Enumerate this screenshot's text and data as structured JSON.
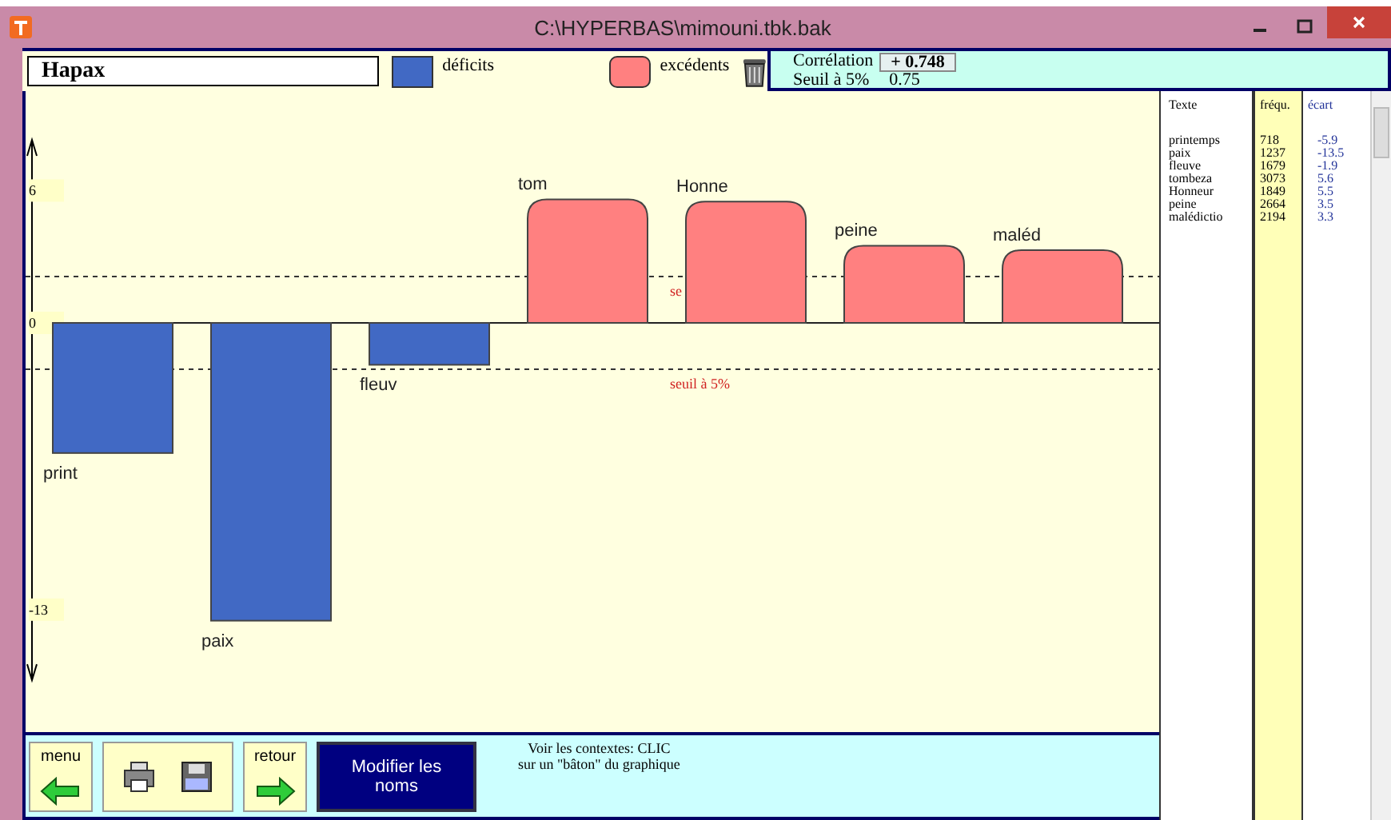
{
  "window": {
    "title": "C:\\HYPERBAS\\mimouni.tbk.bak"
  },
  "toolbar": {
    "name": "Hapax"
  },
  "correlation": {
    "label": "Corrélation",
    "value": "+ 0.748",
    "threshold_label": "Seuil à 5%",
    "threshold_value": "0.75"
  },
  "chart_data": {
    "type": "bar",
    "ylim": [
      -16.2,
      8.3
    ],
    "yticks": [
      6,
      0,
      -13
    ],
    "categories": [
      "print",
      "paix",
      "fleuv",
      "tom",
      "Honne",
      "peine",
      "maléd"
    ],
    "series": [
      {
        "name": "déficits",
        "color": "#4169c4",
        "values": [
          -5.9,
          -13.5,
          -1.9,
          null,
          null,
          null,
          null
        ]
      },
      {
        "name": "excédents",
        "color": "#ff8080",
        "values": [
          null,
          null,
          null,
          5.6,
          5.5,
          3.5,
          3.3
        ]
      }
    ],
    "ref_lines": [
      {
        "axis": "y",
        "value": 2.1,
        "label": "se"
      },
      {
        "axis": "y",
        "value": -2.1,
        "label": "seuil à 5%"
      }
    ]
  },
  "table": {
    "columns": [
      "Texte",
      "fréqu.",
      "écart"
    ],
    "rows": [
      [
        "printemps",
        "718",
        "-5.9"
      ],
      [
        "paix",
        "1237",
        "-13.5"
      ],
      [
        "fleuve",
        "1679",
        "-1.9"
      ],
      [
        "tombeza",
        "3073",
        "5.6"
      ],
      [
        "Honneur",
        "1849",
        "5.5"
      ],
      [
        "peine",
        "2664",
        "3.5"
      ],
      [
        "malédictio",
        "2194",
        "3.3"
      ]
    ]
  },
  "bottom": {
    "menu": "menu",
    "back": "retour",
    "rename": "Modifier les noms",
    "hint": [
      "Voir les contextes: CLIC",
      "sur un \"bâton\" du graphique"
    ]
  }
}
